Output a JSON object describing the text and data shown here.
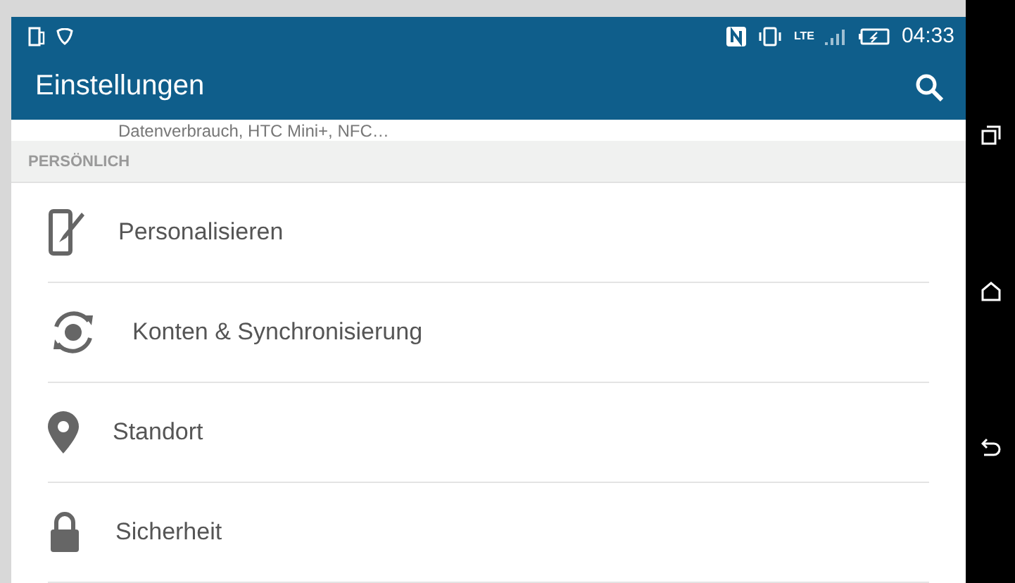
{
  "status_bar": {
    "time": "04:33",
    "network": "LTE"
  },
  "toolbar": {
    "title": "Einstellungen"
  },
  "previous_item_summary": "Datenverbrauch, HTC Mini+, NFC…",
  "section": {
    "title": "PERSÖNLICH"
  },
  "items": [
    {
      "label": "Personalisieren",
      "kind": "personalize"
    },
    {
      "label": "Konten & Synchronisierung",
      "kind": "sync"
    },
    {
      "label": "Standort",
      "kind": "location"
    },
    {
      "label": "Sicherheit",
      "kind": "security"
    }
  ]
}
